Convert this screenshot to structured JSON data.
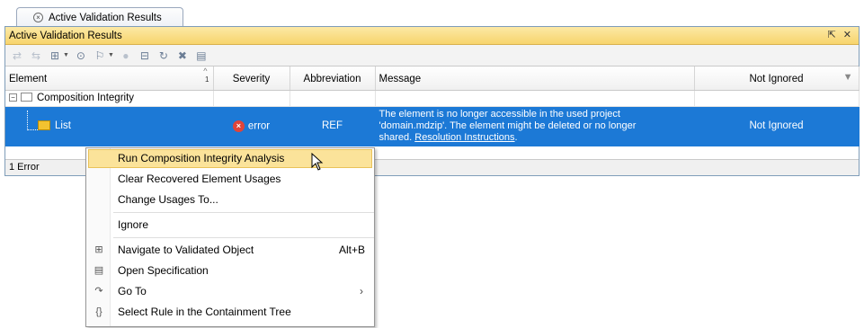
{
  "tab": {
    "title": "Active Validation Results"
  },
  "panel": {
    "title": "Active Validation Results",
    "header_actions": [
      "⇱",
      "✕"
    ]
  },
  "table": {
    "columns": {
      "element": "Element",
      "severity": "Severity",
      "abbreviation": "Abbreviation",
      "message": "Message",
      "not_ignored": "Not Ignored"
    },
    "sort_number": "1",
    "group": {
      "label": "Composition Integrity"
    },
    "row": {
      "element": "List",
      "severity": "error",
      "abbreviation": "REF",
      "message_line1": "The element is no longer accessible in the used project",
      "message_line2": "'domain.mdzip'. The element might be deleted or no longer",
      "message_line3": "shared. ",
      "message_link": "Resolution Instructions",
      "message_end": ".",
      "not_ignored": "Not Ignored"
    }
  },
  "status": {
    "text": "1 Error"
  },
  "context_menu": {
    "run_analysis": "Run Composition Integrity Analysis",
    "clear_usages": "Clear Recovered Element Usages",
    "change_usages": "Change Usages To...",
    "ignore": "Ignore",
    "navigate": "Navigate to Validated Object",
    "navigate_shortcut": "Alt+B",
    "open_spec": "Open Specification",
    "go_to": "Go To",
    "select_rule": "Select Rule in the Containment Tree"
  },
  "colors": {
    "selection": "#1c79d6",
    "header": "#f7d46c",
    "error": "#e0443a",
    "menu_highlight": "#fbe39a"
  }
}
